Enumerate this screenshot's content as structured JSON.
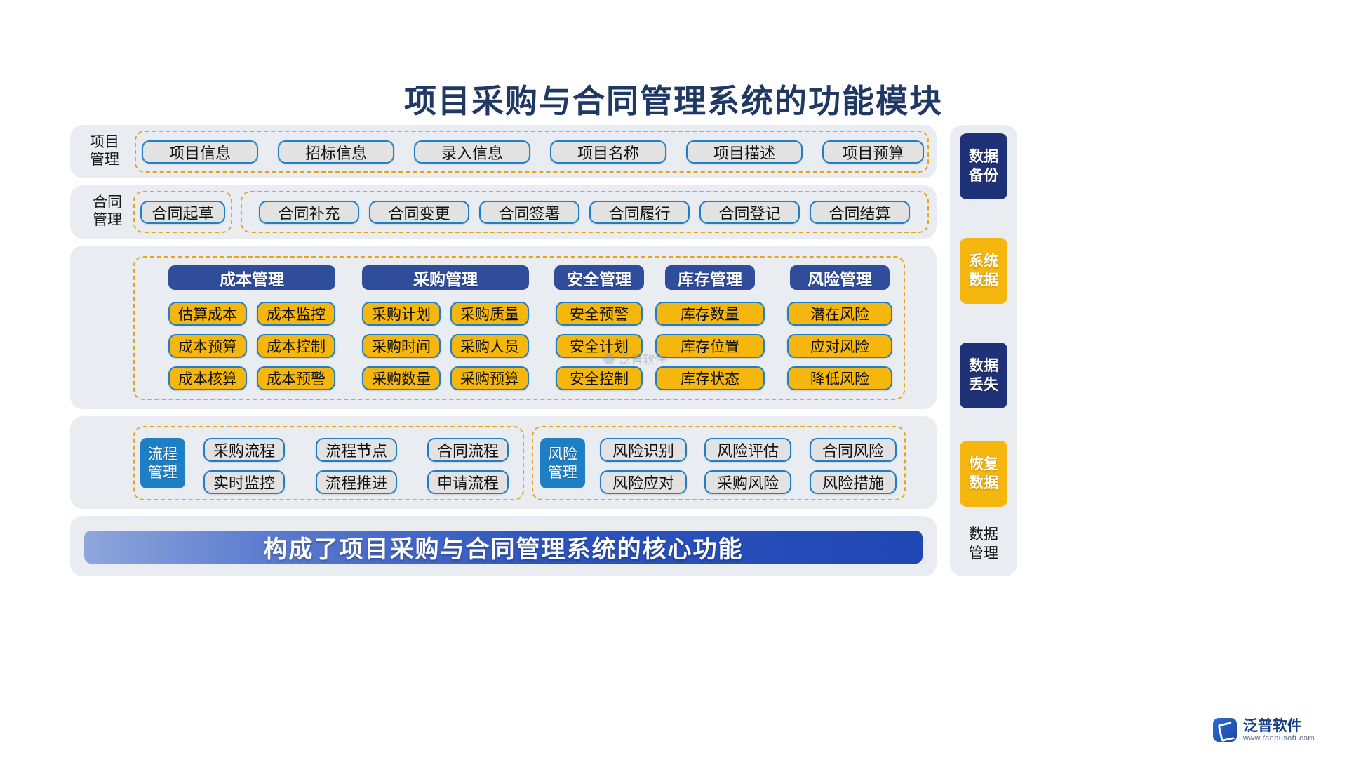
{
  "page": {
    "title": "项目采购与合同管理系统的功能模块"
  },
  "colors": {
    "title": "#1F3864",
    "panel": "#E9EDF2",
    "dashed_border": "#E8A317",
    "pill_bg": "#E2E2E2",
    "pill_border": "#1F7FC4",
    "header_blue": "#2F4D9B",
    "yellow": "#F5B60D",
    "tag_blue": "#1F7FC4",
    "sidebar_navy": "#1F3277",
    "sidebar_gold": "#F5B60D",
    "banner_gradient_start": "#8FA6DC",
    "banner_gradient_end": "#1F46B4"
  },
  "row_project": {
    "label": "项目\n管理",
    "label_line1": "项目",
    "label_line2": "管理",
    "items": [
      "项目信息",
      "招标信息",
      "录入信息",
      "项目名称",
      "项目描述",
      "项目预算"
    ]
  },
  "row_contract": {
    "label_line1": "合同",
    "label_line2": "管理",
    "first_group": [
      "合同起草"
    ],
    "second_group": [
      "合同补充",
      "合同变更",
      "合同签署",
      "合同履行",
      "合同登记",
      "合同结算"
    ]
  },
  "main_section": {
    "columns": [
      {
        "header": "成本管理",
        "items": [
          "估算成本",
          "成本监控",
          "成本预算",
          "成本控制",
          "成本核算",
          "成本预警"
        ],
        "cols": 2
      },
      {
        "header": "采购管理",
        "items": [
          "采购计划",
          "采购质量",
          "采购时间",
          "采购人员",
          "采购数量",
          "采购预算"
        ],
        "cols": 2
      },
      {
        "header": "安全管理",
        "items": [
          "安全预警",
          "安全计划",
          "安全控制"
        ],
        "cols": 1
      },
      {
        "header": "库存管理",
        "items": [
          "库存数量",
          "库存位置",
          "库存状态"
        ],
        "cols": 1
      },
      {
        "header": "风险管理",
        "items": [
          "潜在风险",
          "应对风险",
          "降低风险"
        ],
        "cols": 1
      }
    ]
  },
  "bottom_section": {
    "process_group": {
      "tag_line1": "流程",
      "tag_line2": "管理",
      "items": [
        "采购流程",
        "流程节点",
        "合同流程",
        "实时监控",
        "流程推进",
        "申请流程"
      ]
    },
    "risk_group": {
      "tag_line1": "风险",
      "tag_line2": "管理",
      "items": [
        "风险识别",
        "风险评估",
        "合同风险",
        "风险应对",
        "采购风险",
        "风险措施"
      ]
    }
  },
  "banner": {
    "text": "构成了项目采购与合同管理系统的核心功能"
  },
  "sidebar": {
    "items": [
      {
        "line1": "数据",
        "line2": "备份",
        "style": "navy"
      },
      {
        "line1": "系统",
        "line2": "数据",
        "style": "gold"
      },
      {
        "line1": "数据",
        "line2": "丢失",
        "style": "navy"
      },
      {
        "line1": "恢复",
        "line2": "数据",
        "style": "gold"
      },
      {
        "line1": "数据",
        "line2": "管理",
        "style": "plain"
      }
    ]
  },
  "watermark": {
    "text": "泛普软件"
  },
  "logo": {
    "name": "泛普软件",
    "url": "www.fanpusoft.com"
  }
}
